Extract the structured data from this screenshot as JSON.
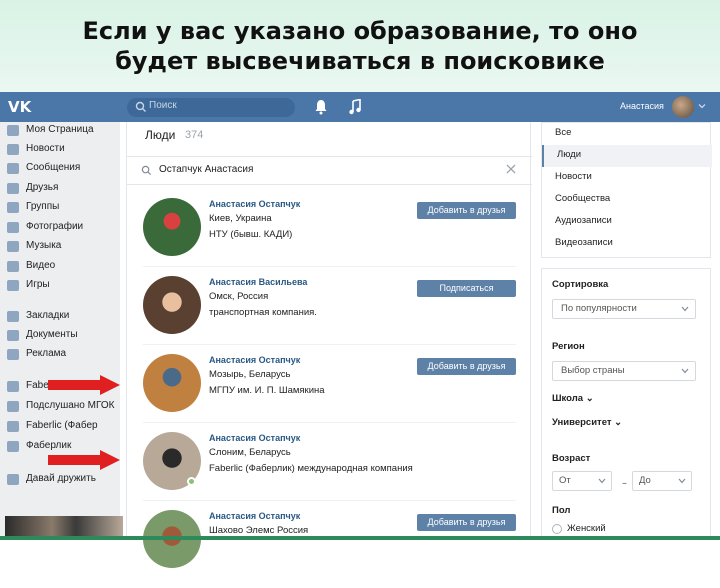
{
  "slide": {
    "title_line1": "Если у вас указано образование, то оно",
    "title_line2": "будет высвечиваться в поисковике"
  },
  "header": {
    "logo": "VK",
    "search_placeholder": "Поиск",
    "user_name": "Анастасия"
  },
  "left_nav": [
    {
      "label": "Моя Страница",
      "icon": "home-icon"
    },
    {
      "label": "Новости",
      "icon": "news-icon"
    },
    {
      "label": "Сообщения",
      "icon": "messages-icon"
    },
    {
      "label": "Друзья",
      "icon": "friends-icon"
    },
    {
      "label": "Группы",
      "icon": "groups-icon"
    },
    {
      "label": "Фотографии",
      "icon": "photos-icon"
    },
    {
      "label": "Музыка",
      "icon": "music-icon"
    },
    {
      "label": "Видео",
      "icon": "video-icon"
    },
    {
      "label": "Игры",
      "icon": "games-icon"
    },
    {
      "label": "Закладки",
      "icon": "bookmarks-icon"
    },
    {
      "label": "Документы",
      "icon": "documents-icon"
    },
    {
      "label": "Реклама",
      "icon": "ads-icon"
    },
    {
      "label": "Faberlic",
      "icon": "community-icon"
    },
    {
      "label": "Подслушано МГОК",
      "icon": "community-icon"
    },
    {
      "label": "Faberlic (Фабер",
      "icon": "community-icon"
    },
    {
      "label": "Фаберлик",
      "icon": "community-icon"
    },
    {
      "label": "Давай дружить",
      "icon": "community-icon"
    }
  ],
  "main": {
    "title": "Люди",
    "count": "374",
    "query": "Остапчук Анастасия",
    "people": [
      {
        "name": "Анастасия Остапчук",
        "line1": "Киев, Украина",
        "line2": "НТУ (бывш. КАДИ)",
        "button": "Добавить в друзья",
        "online": false
      },
      {
        "name": "Анастасия Васильева",
        "line1": "Омск, Россия",
        "line2": "транспортная компания.",
        "button": "Подписаться",
        "online": false
      },
      {
        "name": "Анастасия Остапчук",
        "line1": "Мозырь, Беларусь",
        "line2": "МГПУ им. И. П. Шамякина",
        "button": "Добавить в друзья",
        "online": false
      },
      {
        "name": "Анастасия Остапчук",
        "line1": "Слоним, Беларусь",
        "line2": "Faberlic (Фаберлик) международная компания",
        "button": "",
        "online": true
      },
      {
        "name": "Анастасия Остапчук",
        "line1": "Шахово Элемс Россия",
        "line2": "",
        "button": "Добавить в друзья",
        "online": false
      }
    ]
  },
  "right_menu": [
    {
      "label": "Все",
      "active": false
    },
    {
      "label": "Люди",
      "active": true
    },
    {
      "label": "Новости",
      "active": false
    },
    {
      "label": "Сообщества",
      "active": false
    },
    {
      "label": "Аудиозаписи",
      "active": false
    },
    {
      "label": "Видеозаписи",
      "active": false
    }
  ],
  "filters": {
    "sort_heading": "Сортировка",
    "sort_value": "По популярности",
    "region_heading": "Регион",
    "region_value": "Выбор страны",
    "school_link": "Школа",
    "university_link": "Университет",
    "age_heading": "Возраст",
    "age_from": "От",
    "age_to": "До",
    "gender_heading": "Пол",
    "gender_option": "Женский"
  },
  "colors": {
    "vk_blue": "#4a76a8",
    "button_blue": "#5e81a8",
    "arrow_red": "#e02020",
    "banner_bg": "#d9f2e6"
  }
}
